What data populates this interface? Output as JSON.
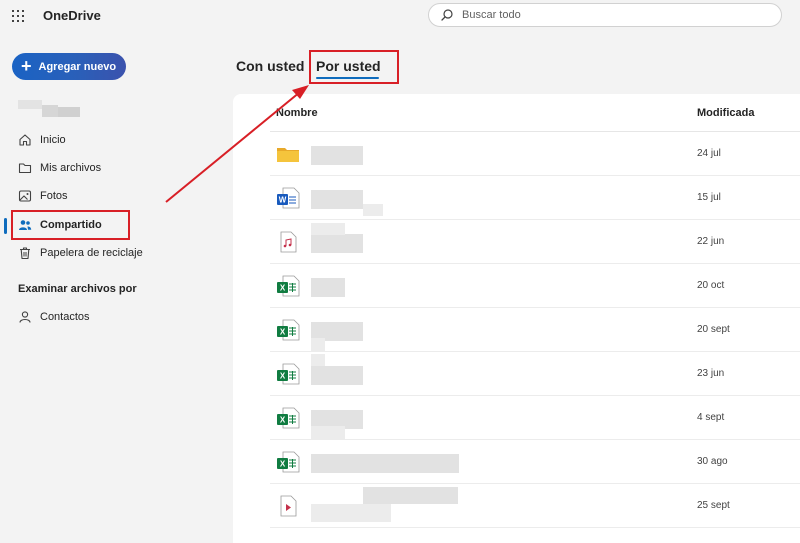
{
  "app": {
    "name": "OneDrive"
  },
  "search": {
    "placeholder": "Buscar todo"
  },
  "sidebar": {
    "new_button": "Agregar nuevo",
    "items": [
      {
        "label": "Inicio",
        "icon": "home-icon"
      },
      {
        "label": "Mis archivos",
        "icon": "folder-icon"
      },
      {
        "label": "Fotos",
        "icon": "image-icon"
      },
      {
        "label": "Compartido",
        "icon": "people-icon",
        "active": true
      },
      {
        "label": "Papelera de reciclaje",
        "icon": "trash-icon"
      }
    ],
    "section_title": "Examinar archivos por",
    "section_items": [
      {
        "label": "Contactos",
        "icon": "person-icon"
      }
    ]
  },
  "tabs": [
    {
      "label": "Con usted"
    },
    {
      "label": "Por usted",
      "selected": true
    }
  ],
  "table": {
    "columns": [
      "Nombre",
      "Modificada"
    ],
    "rows": [
      {
        "type": "folder",
        "modified": "24 jul"
      },
      {
        "type": "word",
        "modified": "15 jul"
      },
      {
        "type": "audio",
        "modified": "22 jun"
      },
      {
        "type": "excel",
        "modified": "20 oct"
      },
      {
        "type": "excel",
        "modified": "20 sept"
      },
      {
        "type": "excel",
        "modified": "23 jun"
      },
      {
        "type": "excel",
        "modified": "4 sept"
      },
      {
        "type": "excel",
        "modified": "30 ago"
      },
      {
        "type": "video",
        "modified": "25 sept"
      }
    ]
  },
  "colors": {
    "accent": "#0f6cbd",
    "annotation": "#d81f26",
    "excel": "#107c41",
    "word": "#185abd",
    "folder": "#f5c43c"
  }
}
